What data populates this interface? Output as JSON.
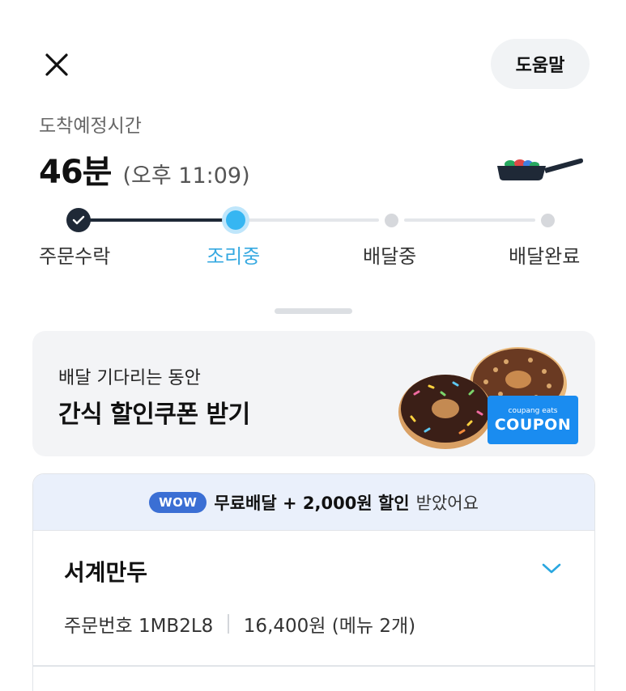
{
  "header": {
    "help_label": "도움말"
  },
  "eta": {
    "label": "도착예정시간",
    "minutes": "46분",
    "time": "(오후 11:09)"
  },
  "progress": {
    "steps": [
      {
        "label": "주문수락",
        "state": "done"
      },
      {
        "label": "조리중",
        "state": "current"
      },
      {
        "label": "배달중",
        "state": "todo"
      },
      {
        "label": "배달완료",
        "state": "todo"
      }
    ],
    "accent_color": "#36b6f2",
    "done_color": "#1f2937"
  },
  "promo": {
    "subtitle": "배달 기다리는 동안",
    "title": "간식 할인쿠폰 받기",
    "coupon_brand": "coupang eats",
    "coupon_word": "COUPON"
  },
  "order": {
    "wow_badge": "WOW",
    "wow_strong": "무료배달 + 2,000원 할인",
    "wow_tail": "받았어요",
    "store_name": "서계만두",
    "order_number": "주문번호 1MB2L8",
    "order_summary": "16,400원 (메뉴 2개)"
  },
  "icons": {
    "close": "close-icon",
    "pan": "frying-pan-icon",
    "chevron": "chevron-down-icon",
    "check": "check-icon"
  }
}
